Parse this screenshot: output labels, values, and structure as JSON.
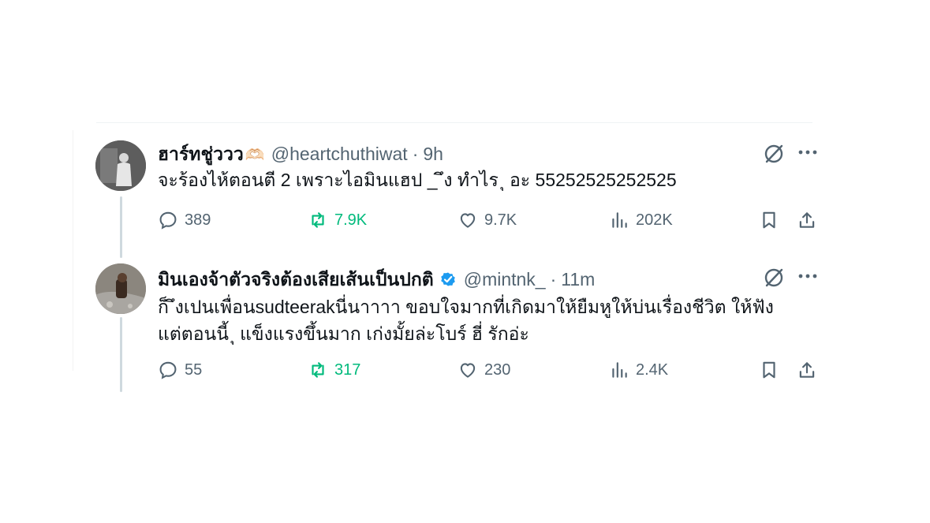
{
  "tweets": [
    {
      "display_name": "ฮาร์ทชู่ววว",
      "name_emoji": "🫶🏻",
      "handle": "@heartchuthiwat",
      "separator": "·",
      "time": "9h",
      "text": "จะร้องไห้ตอนตี 2 เพราะไอมินแฮป _ ึง ทำไร ุ อะ 55252525252525",
      "stats": {
        "replies": "389",
        "retweets": "7.9K",
        "likes": "9.7K",
        "views": "202K"
      }
    },
    {
      "display_name": "มินเองจ้าตัวจริงต้องเสียเส้นเป็นปกติ",
      "verified": true,
      "handle": "@mintnk_",
      "separator": "·",
      "time": "11m",
      "text_line1": "ก็ ึงเปนเพื่อนsudteerakนี่นาาาา ขอบใจมากที่เกิดมาให้ยืมหูให้บ่นเรื่องชีวิต ให้ฟัง",
      "text_line2": "แต่ตอนนี้ ุ แข็งแรงขึ้นมาก เก่งมั้ยล่ะโบร์ ฮี่ รักอ่ะ",
      "stats": {
        "replies": "55",
        "retweets": "317",
        "likes": "230",
        "views": "2.4K"
      }
    }
  ],
  "colors": {
    "text": "#0f1419",
    "secondary": "#536471",
    "retweet_active": "#00ba7c",
    "verified": "#1d9bf0",
    "thread_line": "#cfd9de"
  },
  "icons": [
    "grok-icon",
    "more-icon",
    "reply-icon",
    "retweet-icon",
    "like-icon",
    "views-icon",
    "bookmark-icon",
    "share-icon",
    "verified-icon"
  ]
}
